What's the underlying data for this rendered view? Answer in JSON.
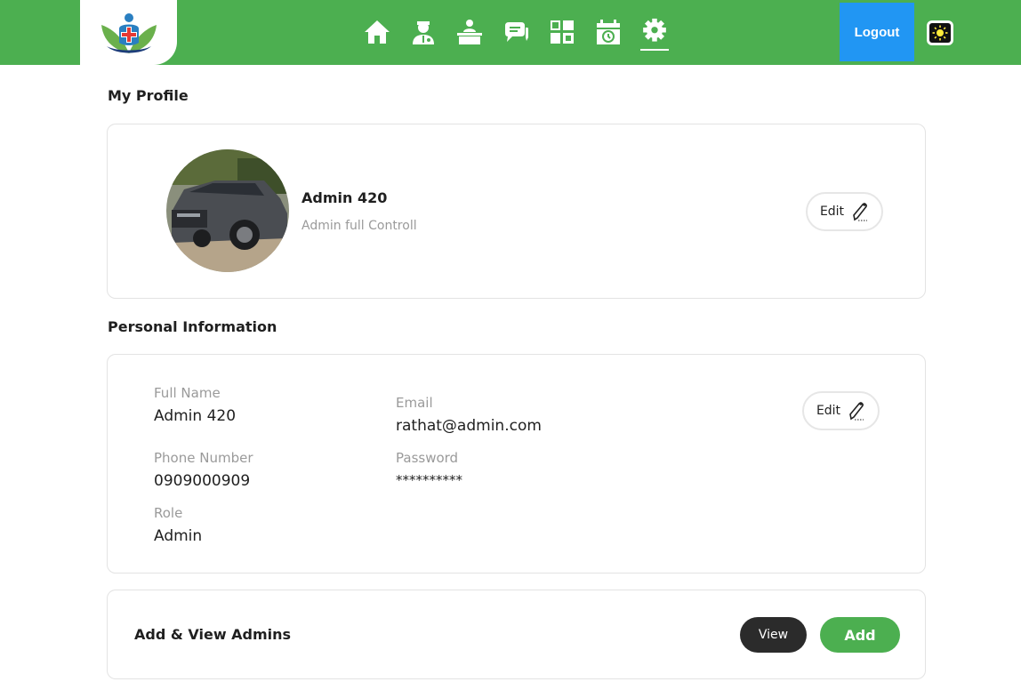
{
  "navbar": {
    "logo_icon": "medical-cross-leaf-logo",
    "items": [
      {
        "icon": "home-icon",
        "name": "nav-home"
      },
      {
        "icon": "doctor-icon",
        "name": "nav-doctors"
      },
      {
        "icon": "reception-desk-icon",
        "name": "nav-reception"
      },
      {
        "icon": "chat-icon",
        "name": "nav-messages"
      },
      {
        "icon": "grid-icon",
        "name": "nav-departments"
      },
      {
        "icon": "calendar-icon",
        "name": "nav-appointments"
      },
      {
        "icon": "gear-icon",
        "name": "nav-settings",
        "active": true
      }
    ],
    "logout_label": "Logout",
    "theme_icon": "sun-icon",
    "colors": {
      "primary": "#4caf50",
      "logout": "#2196f3"
    }
  },
  "profile": {
    "section_title": "My Profile",
    "name": "Admin 420",
    "subtitle": "Admin full Controll",
    "edit_label": "Edit"
  },
  "personal": {
    "section_title": "Personal Information",
    "edit_label": "Edit",
    "fields": {
      "full_name": {
        "label": "Full Name",
        "value": "Admin 420"
      },
      "email": {
        "label": "Email",
        "value": "rathat@admin.com"
      },
      "phone": {
        "label": "Phone Number",
        "value": "0909000909"
      },
      "password": {
        "label": "Password",
        "value": "**********"
      },
      "role": {
        "label": "Role",
        "value": "Admin"
      }
    }
  },
  "admins": {
    "title": "Add & View Admins",
    "view_label": "View",
    "add_label": "Add",
    "colors": {
      "view": "#2b2b2b",
      "add": "#4caf50"
    }
  }
}
